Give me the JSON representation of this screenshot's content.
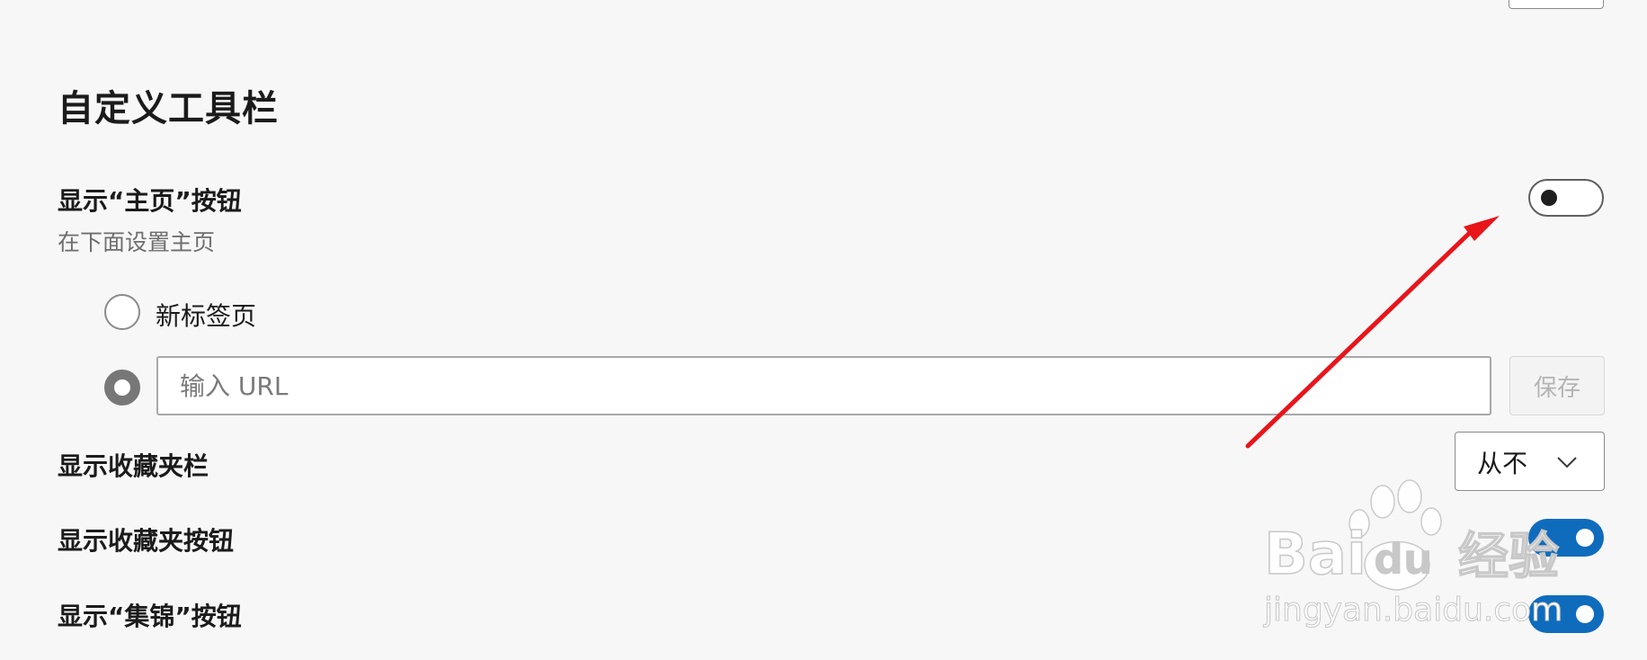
{
  "toolbar_section": {
    "title": "自定义工具栏",
    "home_button": {
      "label": "显示“主页”按钮",
      "sublabel": "在下面设置主页",
      "toggle_on": false
    },
    "home_options": {
      "new_tab_label": "新标签页",
      "new_tab_selected": false,
      "url_selected": true,
      "url_placeholder": "输入 URL",
      "url_value": "",
      "save_label": "保存"
    },
    "favorites_bar": {
      "label": "显示收藏夹栏",
      "selected_value": "从不"
    },
    "favorites_button": {
      "label": "显示收藏夹按钮",
      "toggle_on": true
    },
    "collections_button": {
      "label": "显示“集锦”按钮",
      "toggle_on": true
    }
  },
  "watermark": {
    "brand_latin": "Bai",
    "brand_du": "du",
    "brand_cn": "经验",
    "url": "jingyan.baidu.com"
  },
  "colors": {
    "background": "#f7f7f7",
    "toggle_on": "#0f6cbd",
    "annotation_arrow": "#e8151b"
  }
}
